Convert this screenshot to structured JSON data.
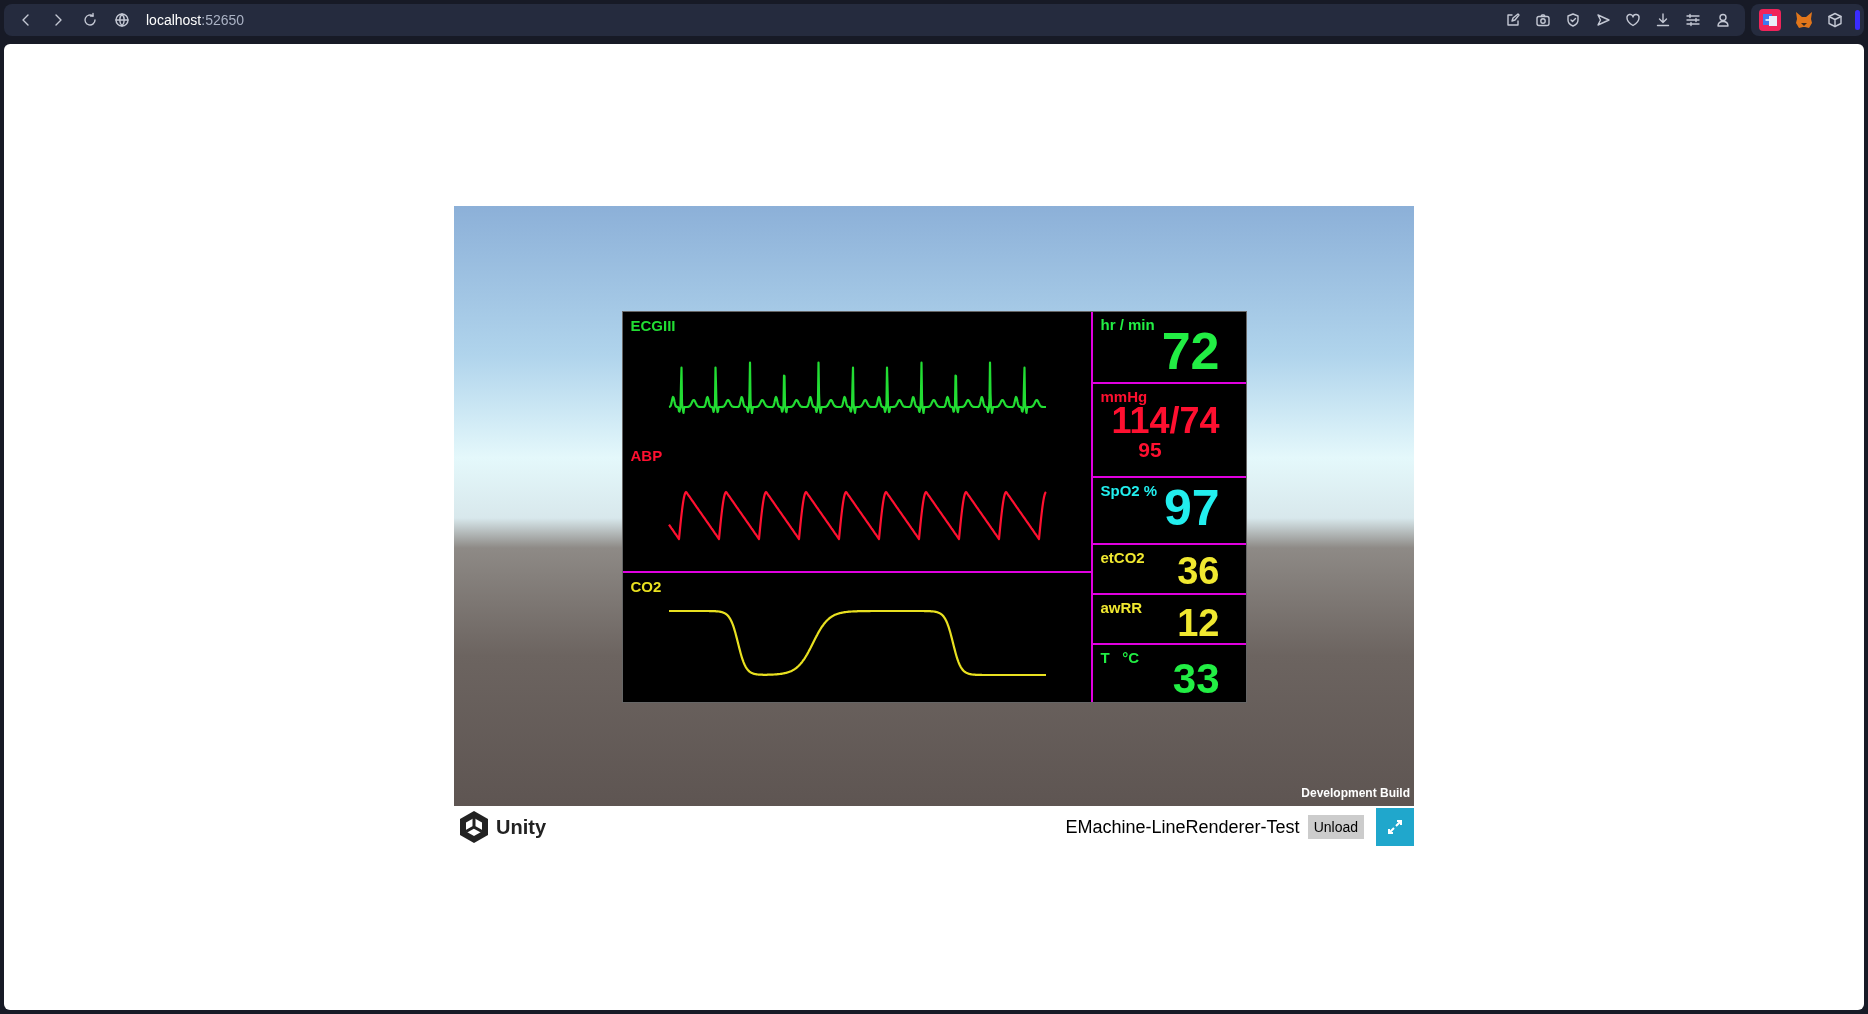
{
  "browser": {
    "host": "localhost",
    "port": ":52650"
  },
  "monitor": {
    "waveforms": [
      {
        "label": "ECGIII",
        "color": "#22dd33",
        "kind": "ecg"
      },
      {
        "label": "ABP",
        "color": "#ff1030",
        "kind": "abp"
      },
      {
        "label": "CO2",
        "color": "#e8e020",
        "kind": "co2"
      }
    ],
    "vitals": [
      {
        "label": "hr / min",
        "value": "72",
        "color": "#22ee44"
      },
      {
        "label": "mmHg",
        "value": "114/74",
        "sub_value": "95",
        "color": "#ff1030"
      },
      {
        "label": "SpO2 %",
        "value": "97",
        "color": "#22eeee"
      },
      {
        "label": "etCO2",
        "value": "36",
        "color": "#f0e830"
      },
      {
        "label": "awRR",
        "value": "12",
        "color": "#f0e830"
      },
      {
        "label": "T   °C",
        "value": "33",
        "color": "#22ee44"
      }
    ]
  },
  "build_label": "Development Build",
  "footer": {
    "logo_text": "Unity",
    "app_title": "EMachine-LineRenderer-Test",
    "unload_button": "Unload"
  }
}
